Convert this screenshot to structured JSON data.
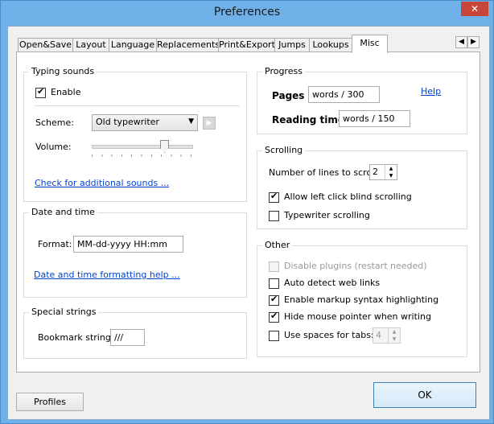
{
  "window": {
    "title": "Preferences",
    "close_glyph": "✕"
  },
  "tabs": [
    {
      "label": "Open&Save"
    },
    {
      "label": "Layout"
    },
    {
      "label": "Language"
    },
    {
      "label": "Replacements"
    },
    {
      "label": "Print&Export"
    },
    {
      "label": "Jumps"
    },
    {
      "label": "Lookups"
    },
    {
      "label": "Misc"
    }
  ],
  "active_tab": "Misc",
  "tab_scroll": {
    "left_glyph": "◀",
    "right_glyph": "▶"
  },
  "typing_sounds": {
    "title": "Typing sounds",
    "enable_label": "Enable",
    "enable_checked": true,
    "scheme_label": "Scheme:",
    "scheme_value": "Old typewriter",
    "play_glyph": "▶",
    "volume_label": "Volume:",
    "volume_level": 0.75,
    "check_link": "Check for additional sounds ..."
  },
  "date_time": {
    "title": "Date and time",
    "format_label": "Format:",
    "format_value": "MM-dd-yyyy HH:mm",
    "help_link": "Date and time formatting help ..."
  },
  "special_strings": {
    "title": "Special strings",
    "bookmark_label": "Bookmark string:",
    "bookmark_value": "///"
  },
  "progress": {
    "title": "Progress",
    "pages_label": "Pages",
    "pages_value": "words / 300",
    "reading_label": "Reading time",
    "reading_value": "words / 150",
    "help_link": "Help"
  },
  "scrolling": {
    "title": "Scrolling",
    "lines_label": "Number of lines to scroll:",
    "lines_value": "2",
    "blind_label": "Allow left click blind scrolling",
    "blind_checked": true,
    "typewriter_label": "Typewriter scrolling",
    "typewriter_checked": false
  },
  "other": {
    "title": "Other",
    "plugins_label": "Disable plugins (restart needed)",
    "plugins_checked": false,
    "autolinks_label": "Auto detect web links",
    "autolinks_checked": false,
    "markup_label": "Enable markup syntax highlighting",
    "markup_checked": true,
    "hide_mouse_label": "Hide mouse pointer when writing",
    "hide_mouse_checked": true,
    "spaces_label": "Use spaces for tabs:",
    "spaces_checked": false,
    "spaces_value": "4"
  },
  "footer": {
    "profiles_label": "Profiles",
    "ok_label": "OK"
  },
  "colors": {
    "titlebar": "#6fb0e8",
    "close": "#c7463a",
    "link": "#0044cc"
  }
}
